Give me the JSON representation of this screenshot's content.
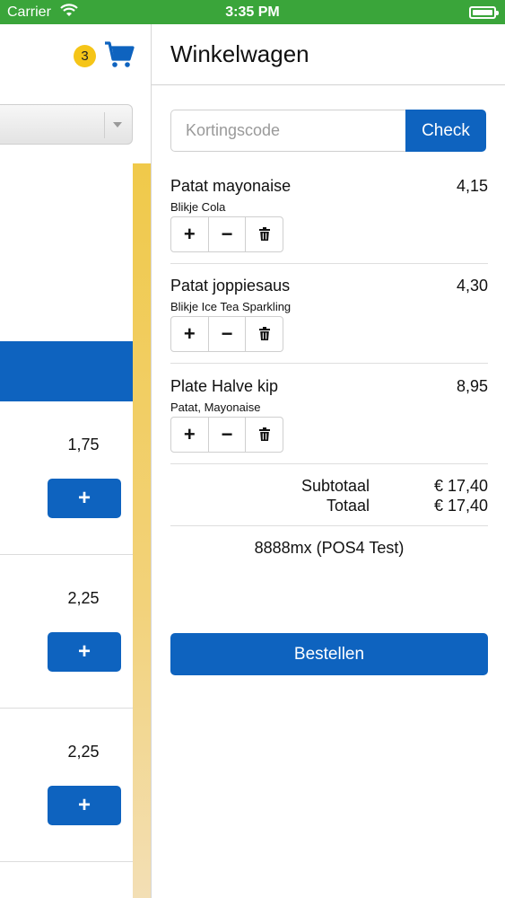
{
  "status_bar": {
    "carrier": "Carrier",
    "time": "3:35 PM"
  },
  "header": {
    "cart_count": "3"
  },
  "left_products": [
    {
      "price": "1,75",
      "add_label": "+"
    },
    {
      "price": "2,25",
      "add_label": "+"
    },
    {
      "price": "2,25",
      "add_label": "+"
    }
  ],
  "cart": {
    "title": "Winkelwagen",
    "coupon_placeholder": "Kortingscode",
    "check_label": "Check",
    "items": [
      {
        "name": "Patat mayonaise",
        "sub": "Blikje Cola",
        "price": "4,15"
      },
      {
        "name": "Patat joppiesaus",
        "sub": "Blikje Ice Tea Sparkling",
        "price": "4,30"
      },
      {
        "name": "Plate Halve kip",
        "sub": "Patat, Mayonaise",
        "price": "8,95"
      }
    ],
    "controls": {
      "plus": "+",
      "minus": "−"
    },
    "subtotal_label": "Subtotaal",
    "subtotal_value": "€ 17,40",
    "total_label": "Totaal",
    "total_value": "€ 17,40",
    "store": "8888mx (POS4 Test)",
    "order_label": "Bestellen"
  },
  "colors": {
    "primary": "#0e63bf",
    "status_bar": "#3aa53a",
    "badge": "#f5c518",
    "accent_bar": "#f0c94a"
  }
}
